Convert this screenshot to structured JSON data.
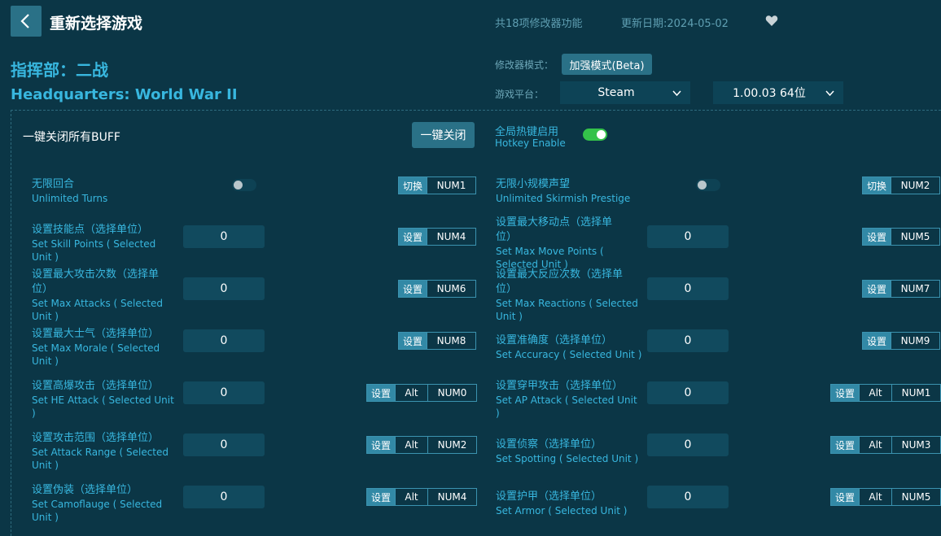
{
  "header": {
    "title": "重新选择游戏",
    "feature_count": "共18项修改器功能",
    "update_date": "更新日期:2024-05-02"
  },
  "game": {
    "title_cn": "指挥部：二战",
    "title_en": "Headquarters: World War II"
  },
  "settings": {
    "mode_label": "修改器模式：",
    "mode_value": "加强模式(Beta)",
    "platform_label": "游戏平台：",
    "platform_value": "Steam",
    "version_value": "1.00.03 64位"
  },
  "controls": {
    "close_all_label": "一键关闭所有BUFF",
    "close_all_button": "一键关闭",
    "hotkey_cn": "全局热键启用",
    "hotkey_en": "Hotkey Enable",
    "hotkey_enabled": true
  },
  "left_items": [
    {
      "cn": "无限回合",
      "en": "Unlimited Turns",
      "type": "toggle",
      "on": false,
      "action": "切换",
      "keys": [
        "NUM1"
      ]
    },
    {
      "cn": "设置技能点（选择单位）",
      "en": "Set Skill Points ( Selected\nUnit )",
      "type": "value",
      "value": "0",
      "action": "设置",
      "keys": [
        "NUM4"
      ]
    },
    {
      "cn": "设置最大攻击次数（选择单\n位）",
      "en": "Set Max Attacks ( Selected\nUnit )",
      "type": "value",
      "value": "0",
      "action": "设置",
      "keys": [
        "NUM6"
      ]
    },
    {
      "cn": "设置最大士气（选择单位）",
      "en": "Set Max Morale ( Selected\nUnit )",
      "type": "value",
      "value": "0",
      "action": "设置",
      "keys": [
        "NUM8"
      ]
    },
    {
      "cn": "设置高爆攻击（选择单位）",
      "en": "Set HE Attack ( Selected Unit\n)",
      "type": "value",
      "value": "0",
      "action": "设置",
      "keys": [
        "Alt",
        "NUM0"
      ]
    },
    {
      "cn": "设置攻击范围（选择单位）",
      "en": "Set Attack Range ( Selected\nUnit )",
      "type": "value",
      "value": "0",
      "action": "设置",
      "keys": [
        "Alt",
        "NUM2"
      ]
    },
    {
      "cn": "设置伪装（选择单位）",
      "en": "Set Camoflauge ( Selected\nUnit )",
      "type": "value",
      "value": "0",
      "action": "设置",
      "keys": [
        "Alt",
        "NUM4"
      ]
    }
  ],
  "right_items": [
    {
      "cn": "无限小规模声望",
      "en": "Unlimited Skirmish Prestige",
      "type": "toggle",
      "on": false,
      "action": "切换",
      "keys": [
        "NUM2"
      ]
    },
    {
      "cn": "设置最大移动点（选择单\n位）",
      "en": "Set Max Move Points (\nSelected Unit )",
      "type": "value",
      "value": "0",
      "action": "设置",
      "keys": [
        "NUM5"
      ]
    },
    {
      "cn": "设置最大反应次数（选择单\n位）",
      "en": "Set Max Reactions ( Selected\nUnit )",
      "type": "value",
      "value": "0",
      "action": "设置",
      "keys": [
        "NUM7"
      ]
    },
    {
      "cn": "设置准确度（选择单位）",
      "en": "Set Accuracy ( Selected Unit )",
      "type": "value",
      "value": "0",
      "action": "设置",
      "keys": [
        "NUM9"
      ]
    },
    {
      "cn": "设置穿甲攻击（选择单位）",
      "en": "Set AP Attack ( Selected Unit\n)",
      "type": "value",
      "value": "0",
      "action": "设置",
      "keys": [
        "Alt",
        "NUM1"
      ]
    },
    {
      "cn": "设置侦察（选择单位）",
      "en": "Set Spotting ( Selected Unit )",
      "type": "value",
      "value": "0",
      "action": "设置",
      "keys": [
        "Alt",
        "NUM3"
      ]
    },
    {
      "cn": "设置护甲（选择单位）",
      "en": "Set Armor ( Selected Unit )",
      "type": "value",
      "value": "0",
      "action": "设置",
      "keys": [
        "Alt",
        "NUM5"
      ]
    }
  ],
  "icons": {
    "back": "chevron-left-icon",
    "favorite": "heart-icon",
    "dropdown": "chevron-down-icon"
  },
  "colors": {
    "background": "#0b3646",
    "accent": "#38b7df",
    "button": "#2a7187",
    "toggle_on": "#34c24a"
  }
}
